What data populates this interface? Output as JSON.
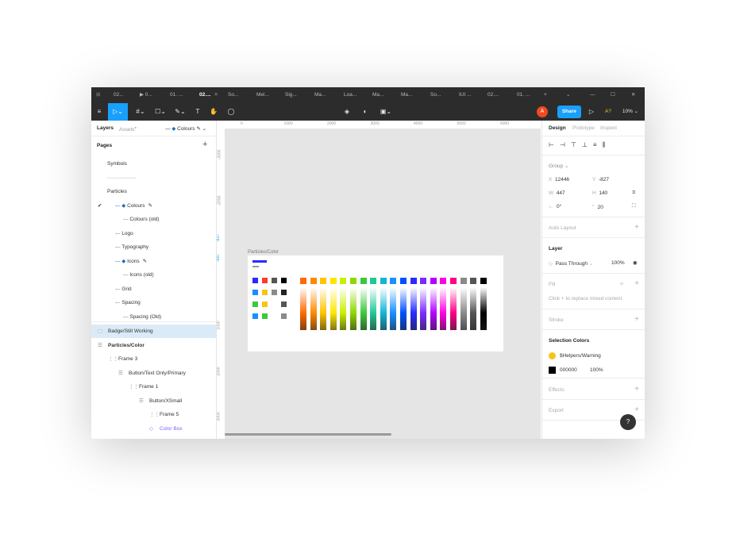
{
  "tabs": [
    {
      "label": "02...",
      "active": false
    },
    {
      "label": "▶ 0...",
      "active": false
    },
    {
      "label": "01. ...",
      "active": false
    },
    {
      "label": "02....",
      "active": true
    },
    {
      "label": "So...",
      "active": false
    },
    {
      "label": "Mel...",
      "active": false
    },
    {
      "label": "Sig...",
      "active": false
    },
    {
      "label": "Ma...",
      "active": false
    },
    {
      "label": "Loa...",
      "active": false
    },
    {
      "label": "Ma...",
      "active": false
    },
    {
      "label": "Ma...",
      "active": false
    },
    {
      "label": "So...",
      "active": false
    },
    {
      "label": "IUI ...",
      "active": false
    },
    {
      "label": "02....",
      "active": false
    },
    {
      "label": "01. ...",
      "active": false
    }
  ],
  "toolbar": {
    "avatar_letter": "A",
    "share_label": "Share",
    "zoom_label": "10%",
    "a_label": "A?"
  },
  "left_panel": {
    "layers_tab": "Layers",
    "assets_tab": "Assets",
    "page_selector": "Colours",
    "pages_title": "Pages",
    "pages": [
      {
        "label": "Symbols",
        "indent": 0,
        "prefix": ""
      },
      {
        "label": "────────",
        "indent": 0,
        "prefix": ""
      },
      {
        "label": "Particles",
        "indent": 0,
        "prefix": ""
      },
      {
        "label": "Colours",
        "indent": 1,
        "prefix": "— ◆",
        "check": true,
        "pen": true,
        "current": true
      },
      {
        "label": "Colours (old)",
        "indent": 2,
        "prefix": "—"
      },
      {
        "label": "Logo",
        "indent": 1,
        "prefix": "—"
      },
      {
        "label": "Typography",
        "indent": 1,
        "prefix": "—"
      },
      {
        "label": "Icons",
        "indent": 1,
        "prefix": "— ◆",
        "pen": true
      },
      {
        "label": "Icons (old)",
        "indent": 2,
        "prefix": "—"
      },
      {
        "label": "Grid",
        "indent": 1,
        "prefix": "—"
      },
      {
        "label": "Spacing",
        "indent": 1,
        "prefix": "—"
      },
      {
        "label": "Spacing (Old)",
        "indent": 2,
        "prefix": "—"
      }
    ],
    "layers": [
      {
        "label": "Badge/Still Working",
        "indent": 0,
        "selected": true
      },
      {
        "label": "Particles/Color",
        "indent": 0,
        "bold": true
      },
      {
        "label": "Frame 3",
        "indent": 1
      },
      {
        "label": "Button/Text Only/Primary",
        "indent": 2
      },
      {
        "label": "Frame 1",
        "indent": 3
      },
      {
        "label": "Button/XSmall",
        "indent": 4
      },
      {
        "label": "Frame 5",
        "indent": 5
      },
      {
        "label": "Color Box",
        "indent": 5,
        "purple": true
      }
    ]
  },
  "canvas": {
    "frame_label": "Particles/Color",
    "ruler_top": [
      "0",
      "1000",
      "2000",
      "3000",
      "4000",
      "5000",
      "6000"
    ],
    "ruler_left": [
      "-3000",
      "-2000",
      "-827",
      "-687",
      "1000",
      "2000",
      "3000"
    ],
    "swatch_colors": [
      "#ff6a00",
      "#ff8800",
      "#ffc400",
      "#ffe600",
      "#c8f000",
      "#8ed800",
      "#3cc83c",
      "#21c896",
      "#11b6d6",
      "#1890ff",
      "#0050ff",
      "#2a2aff",
      "#7a2aff",
      "#b400ff",
      "#ff00e0",
      "#ff0088",
      "#8a8a8a",
      "#555555",
      "#000000"
    ]
  },
  "right_panel": {
    "tabs": [
      "Design",
      "Prototype",
      "Inspect"
    ],
    "group_label": "Group",
    "x_label": "X",
    "x_value": "12446",
    "y_label": "Y",
    "y_value": "-827",
    "w_label": "W",
    "w_value": "447",
    "h_label": "H",
    "h_value": "140",
    "rotation_value": "0°",
    "radius_value": "20",
    "auto_layout": "Auto Layout",
    "layer_title": "Layer",
    "blend_mode": "Pass Through",
    "opacity": "100%",
    "fill_title": "Fill",
    "fill_hint": "Click + to replace mixed content.",
    "stroke_title": "Stroke",
    "selection_colors_title": "Selection Colors",
    "selection_colors": [
      {
        "name": "$Helpers/Warning",
        "color": "#f5c518",
        "opacity": ""
      },
      {
        "name": "000000",
        "color": "#000000",
        "opacity": "100%"
      }
    ],
    "effects_title": "Effects",
    "export_title": "Export",
    "help_label": "?"
  }
}
